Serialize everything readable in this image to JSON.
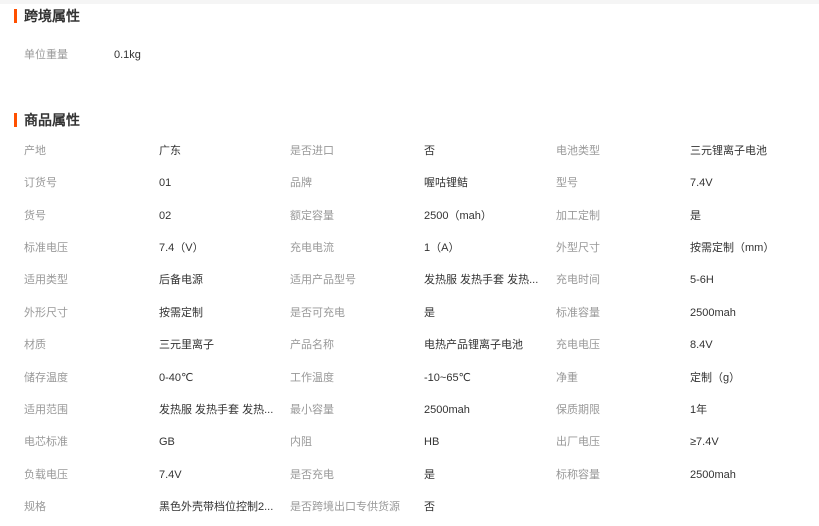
{
  "cross_border": {
    "title": "跨境属性",
    "rows": [
      {
        "label": "单位重量",
        "value": "0.1kg"
      }
    ]
  },
  "product": {
    "title": "商品属性",
    "rows": [
      [
        {
          "label": "产地",
          "value": "广东"
        },
        {
          "label": "是否进口",
          "value": "否"
        },
        {
          "label": "电池类型",
          "value": "三元锂离子电池"
        }
      ],
      [
        {
          "label": "订货号",
          "value": "01"
        },
        {
          "label": "品牌",
          "value": "喔咕锂鲒"
        },
        {
          "label": "型号",
          "value": "7.4V"
        }
      ],
      [
        {
          "label": "货号",
          "value": "02"
        },
        {
          "label": "额定容量",
          "value": "2500（mah）"
        },
        {
          "label": "加工定制",
          "value": "是"
        }
      ],
      [
        {
          "label": "标准电压",
          "value": "7.4（V）"
        },
        {
          "label": "充电电流",
          "value": "1（A）"
        },
        {
          "label": "外型尺寸",
          "value": "按需定制（mm）"
        }
      ],
      [
        {
          "label": "适用类型",
          "value": "后备电源"
        },
        {
          "label": "适用产品型号",
          "value": "发热服 发热手套 发热..."
        },
        {
          "label": "充电时间",
          "value": "5-6H"
        }
      ],
      [
        {
          "label": "外形尺寸",
          "value": "按需定制"
        },
        {
          "label": "是否可充电",
          "value": "是"
        },
        {
          "label": "标准容量",
          "value": "2500mah"
        }
      ],
      [
        {
          "label": "材质",
          "value": "三元里离子"
        },
        {
          "label": "产品名称",
          "value": "电热产品锂离子电池"
        },
        {
          "label": "充电电压",
          "value": "8.4V"
        }
      ],
      [
        {
          "label": "储存温度",
          "value": "0-40℃"
        },
        {
          "label": "工作温度",
          "value": "-10~65℃"
        },
        {
          "label": "净重",
          "value": "定制（g）"
        }
      ],
      [
        {
          "label": "适用范围",
          "value": "发热服 发热手套 发热..."
        },
        {
          "label": "最小容量",
          "value": "2500mah"
        },
        {
          "label": "保质期限",
          "value": "1年"
        }
      ],
      [
        {
          "label": "电芯标准",
          "value": "GB"
        },
        {
          "label": "内阻",
          "value": "HB"
        },
        {
          "label": "出厂电压",
          "value": "≥7.4V"
        }
      ],
      [
        {
          "label": "负载电压",
          "value": "7.4V"
        },
        {
          "label": "是否充电",
          "value": "是"
        },
        {
          "label": "标称容量",
          "value": "2500mah"
        }
      ],
      [
        {
          "label": "规格",
          "value": "黑色外壳带档位控制2..."
        },
        {
          "label": "是否跨境出口专供货源",
          "value": "否"
        }
      ]
    ]
  },
  "colors": {
    "accent": "#ff5000",
    "label": "#999999",
    "value": "#333333"
  }
}
